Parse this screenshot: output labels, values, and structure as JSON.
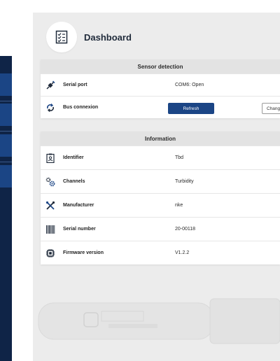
{
  "header": {
    "title": "Dashboard",
    "icon": "checklist-icon"
  },
  "sensor_detection": {
    "title": "Sensor detection",
    "rows": [
      {
        "icon": "plug-icon",
        "label": "Serial port",
        "value": "COM6: Open"
      },
      {
        "icon": "refresh-icon",
        "label": "Bus connexion"
      }
    ],
    "refresh_label": "Refresh",
    "change_label": "Change"
  },
  "information": {
    "title": "Information",
    "rows": [
      {
        "icon": "id-badge-icon",
        "label": "Identifier",
        "value": "Tbd"
      },
      {
        "icon": "gears-icon",
        "label": "Channels",
        "value": "Turbidity"
      },
      {
        "icon": "tools-icon",
        "label": "Manufacturer",
        "value": "nke"
      },
      {
        "icon": "barcode-icon",
        "label": "Serial number",
        "value": "20-00118"
      },
      {
        "icon": "chip-icon",
        "label": "Firmware version",
        "value": "V1.2.2"
      }
    ]
  },
  "colors": {
    "navy": "#0f2447",
    "accent_blue": "#1b4585",
    "canvas": "#ececec"
  }
}
